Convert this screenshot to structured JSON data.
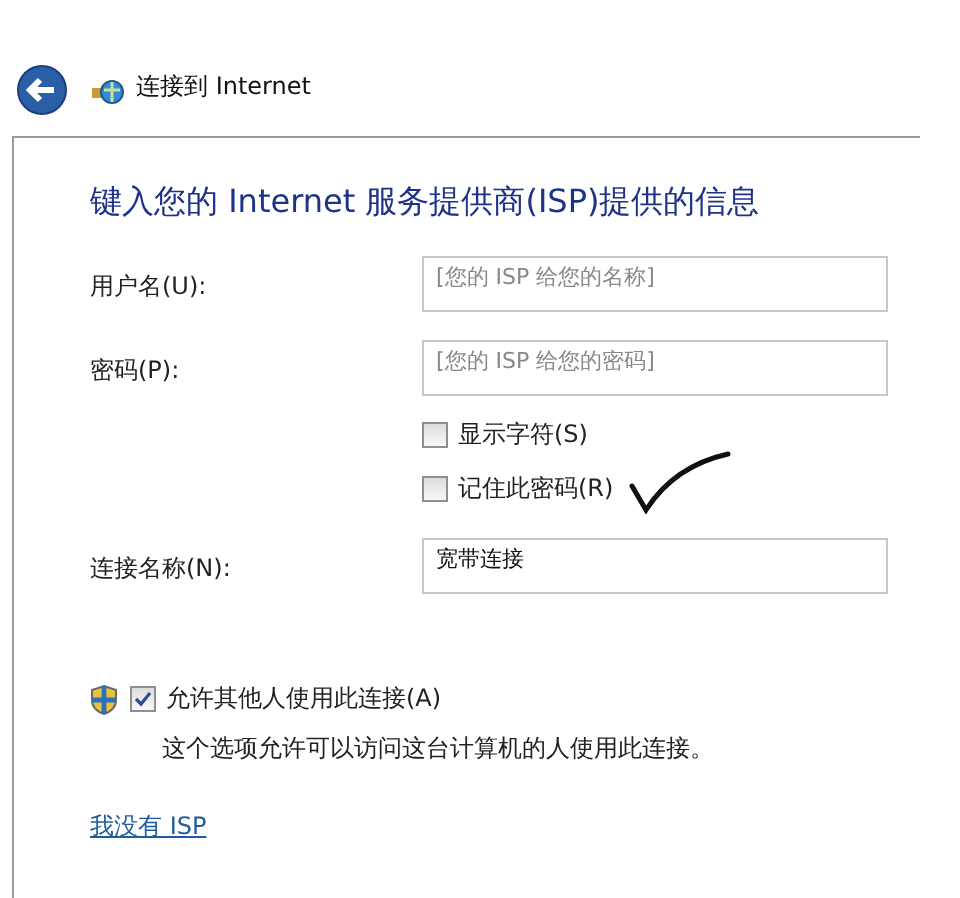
{
  "window": {
    "title": "连接到 Internet"
  },
  "heading": "键入您的 Internet 服务提供商(ISP)提供的信息",
  "fields": [
    {
      "label": "用户名(U):",
      "placeholder": "[您的 ISP 给您的名称]"
    },
    {
      "label": "密码(P):",
      "placeholder": "[您的 ISP 给您的密码]"
    }
  ],
  "checkboxes": [
    {
      "label": "显示字符(S)",
      "checked": false
    },
    {
      "label": "记住此密码(R)",
      "checked": false
    }
  ],
  "connection_name": {
    "label": "连接名称(N):",
    "value": "宽带连接"
  },
  "allow_others": {
    "label": "允许其他人使用此连接(A)",
    "checked": true,
    "description": "这个选项允许可以访问这台计算机的人使用此连接。"
  },
  "link": "我没有 ISP"
}
